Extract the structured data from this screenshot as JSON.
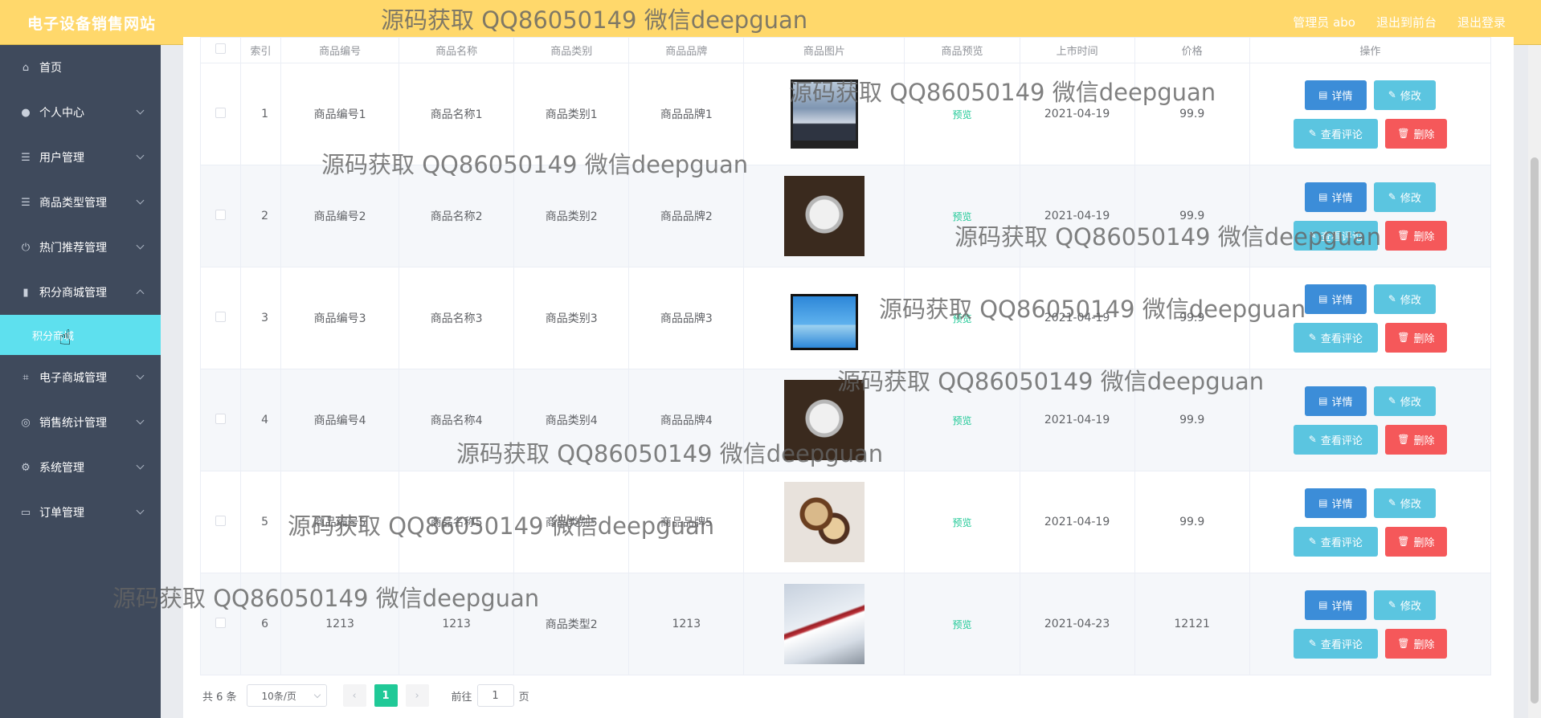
{
  "header": {
    "brand": "电子设备销售网站",
    "user_label": "管理员 abo",
    "back_frontend": "退出到前台",
    "logout": "退出登录"
  },
  "sidebar": {
    "items": [
      {
        "label": "首页",
        "icon": "home-icon",
        "has_arrow": false
      },
      {
        "label": "个人中心",
        "icon": "user-icon",
        "has_arrow": true
      },
      {
        "label": "用户管理",
        "icon": "list-icon",
        "has_arrow": true
      },
      {
        "label": "商品类型管理",
        "icon": "list-icon",
        "has_arrow": true
      },
      {
        "label": "热门推荐管理",
        "icon": "power-icon",
        "has_arrow": true
      },
      {
        "label": "积分商城管理",
        "icon": "book-icon",
        "has_arrow": true,
        "expanded": true
      }
    ],
    "active_sub": "积分商城",
    "items_after": [
      {
        "label": "电子商城管理",
        "icon": "crop-icon"
      },
      {
        "label": "销售统计管理",
        "icon": "compass-icon"
      },
      {
        "label": "系统管理",
        "icon": "settings-icon"
      },
      {
        "label": "订单管理",
        "icon": "chat-icon"
      }
    ]
  },
  "table": {
    "headers": [
      "索引",
      "商品编号",
      "商品名称",
      "商品类别",
      "商品品牌",
      "商品图片",
      "商品预览",
      "上市时间",
      "价格",
      "操作"
    ],
    "rows": [
      {
        "idx": "1",
        "code": "商品编号1",
        "name": "商品名称1",
        "category": "商品类别1",
        "brand": "商品品牌1",
        "image": "tv",
        "preview": "预览",
        "date": "2021-04-19",
        "price": "99.9"
      },
      {
        "idx": "2",
        "code": "商品编号2",
        "name": "商品名称2",
        "category": "商品类别2",
        "brand": "商品品牌2",
        "image": "watch",
        "preview": "预览",
        "date": "2021-04-19",
        "price": "99.9"
      },
      {
        "idx": "3",
        "code": "商品编号3",
        "name": "商品名称3",
        "category": "商品类别3",
        "brand": "商品品牌3",
        "image": "tv-balloon",
        "preview": "预览",
        "date": "2021-04-19",
        "price": "99.9"
      },
      {
        "idx": "4",
        "code": "商品编号4",
        "name": "商品名称4",
        "category": "商品类别4",
        "brand": "商品品牌4",
        "image": "watch",
        "preview": "预览",
        "date": "2021-04-19",
        "price": "99.9"
      },
      {
        "idx": "5",
        "code": "商品编号5",
        "name": "商品名称5",
        "category": "商品类别5",
        "brand": "商品品牌5",
        "image": "watch-pair",
        "preview": "预览",
        "date": "2021-04-19",
        "price": "99.9"
      },
      {
        "idx": "6",
        "code": "1213",
        "name": "1213",
        "category": "商品类型2",
        "brand": "1213",
        "image": "train",
        "preview": "预览",
        "date": "2021-04-23",
        "price": "12121"
      }
    ],
    "buttons": {
      "detail": "详情",
      "edit": "修改",
      "comments": "查看评论",
      "delete": "删除"
    }
  },
  "pagination": {
    "total": "共 6 条",
    "page_size": "10条/页",
    "current_page": "1",
    "goto_prefix": "前往",
    "goto_value": "1",
    "goto_suffix": "页"
  },
  "watermark": "源码获取 QQ86050149 微信deepguan",
  "colors": {
    "header_bg": "#ffd86b",
    "sidebar_bg": "#3f4a5c",
    "active_sub_bg": "#5ee0ee",
    "preview_link": "#20c997",
    "btn_detail": "#3c8dd8",
    "btn_edit": "#5bc5e0",
    "btn_delete": "#f5585a"
  }
}
